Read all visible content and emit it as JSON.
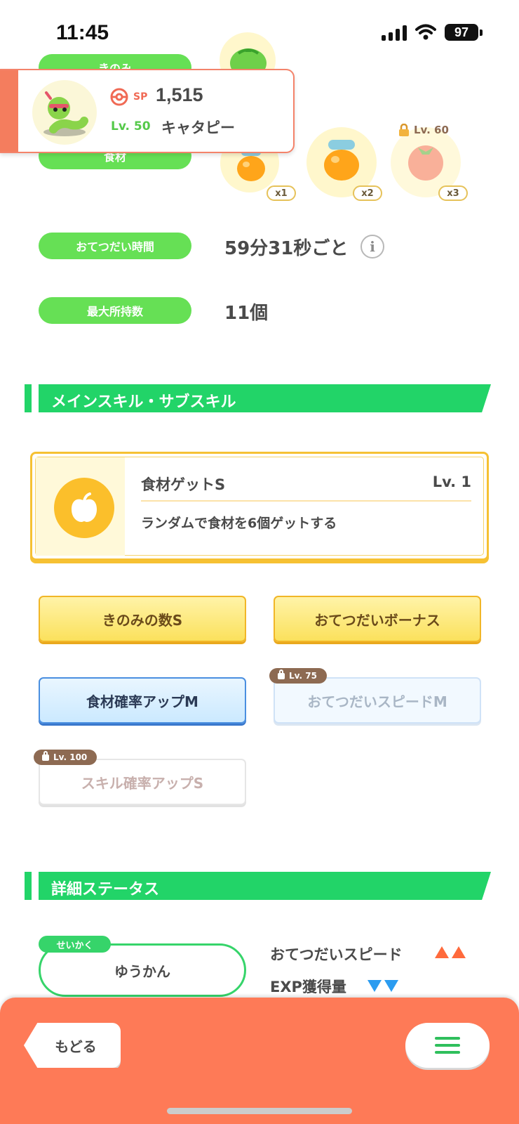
{
  "status_bar": {
    "time": "11:45",
    "battery": "97"
  },
  "berries": {
    "label": "きのみ"
  },
  "ingredients": {
    "label": "食材",
    "items": [
      {
        "count": "x1"
      },
      {
        "count": "x2"
      },
      {
        "count": "x3",
        "lock_level": "Lv. 60"
      }
    ]
  },
  "pokemon": {
    "sp_label": "SP",
    "sp_value": "1,515",
    "level": "Lv. 50",
    "name": "キャタピー"
  },
  "help_time": {
    "label": "おてつだい時間",
    "value": "59分31秒ごと"
  },
  "max_carry": {
    "label": "最大所持数",
    "value": "11個"
  },
  "skills_section": {
    "title": "メインスキル・サブスキル"
  },
  "main_skill": {
    "name": "食材ゲットS",
    "level": "Lv. 1",
    "description": "ランダムで食材を6個ゲットする"
  },
  "sub_skills": [
    {
      "label": "きのみの数S"
    },
    {
      "label": "おてつだいボーナス"
    },
    {
      "label": "食材確率アップM"
    },
    {
      "label": "おてつだいスピードM",
      "lock_level": "Lv. 75"
    },
    {
      "label": "スキル確率アップS",
      "lock_level": "Lv. 100"
    }
  ],
  "details_section": {
    "title": "詳細ステータス"
  },
  "nature": {
    "label": "せいかく",
    "value": "ゆうかん"
  },
  "nature_effects": [
    {
      "label": "おてつだいスピード",
      "direction": "up"
    },
    {
      "label": "EXP獲得量",
      "direction": "down"
    }
  ],
  "bottom_nav": {
    "back_label": "もどる"
  },
  "colors": {
    "accent_green": "#22d468",
    "pill_green": "#66e055",
    "bottom_bar": "#fe7a57",
    "gold": "#f6c133",
    "blue": "#4a8fe0"
  }
}
